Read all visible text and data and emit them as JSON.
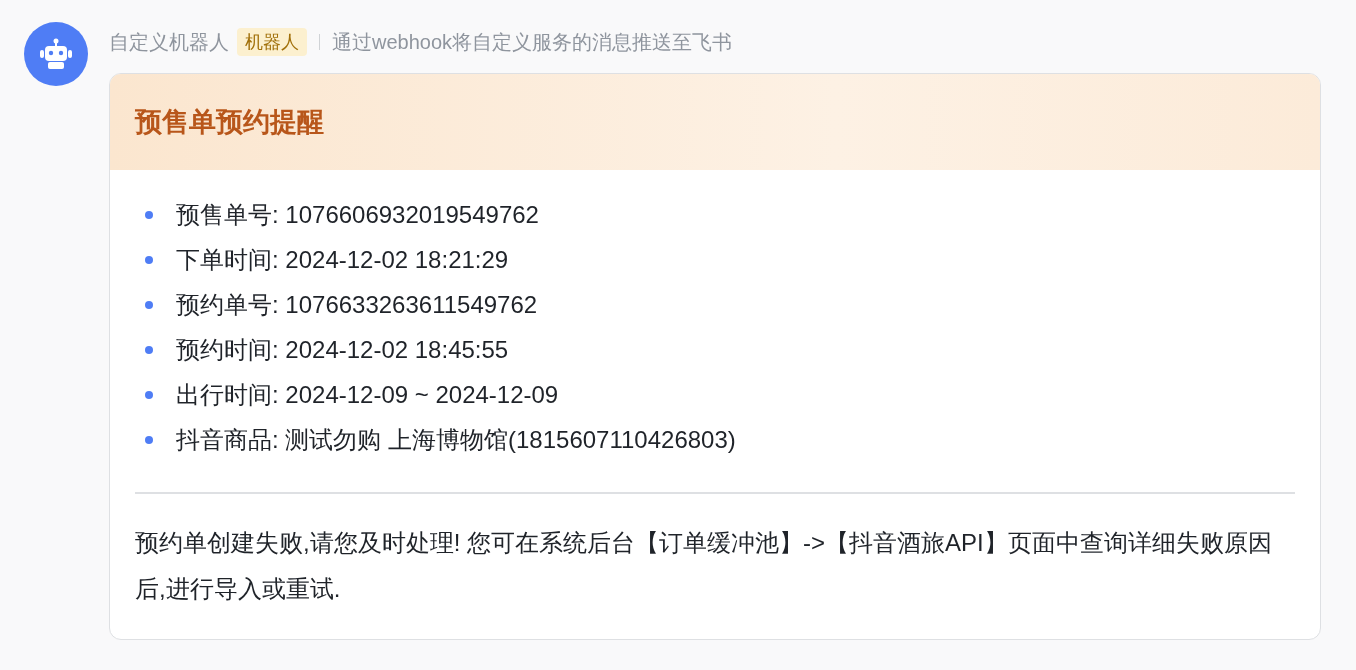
{
  "sender": {
    "name": "自定义机器人",
    "badge": "机器人",
    "description": "通过webhook将自定义服务的消息推送至飞书"
  },
  "card": {
    "title": "预售单预约提醒",
    "items": [
      {
        "label": "预售单号:",
        "value": "1076606932019549762"
      },
      {
        "label": "下单时间:",
        "value": "2024-12-02 18:21:29"
      },
      {
        "label": "预约单号:",
        "value": "1076633263611549762"
      },
      {
        "label": "预约时间:",
        "value": "2024-12-02 18:45:55"
      },
      {
        "label": "出行时间:",
        "value": "2024-12-09 ~ 2024-12-09"
      },
      {
        "label": "抖音商品:",
        "value": "测试勿购 上海博物馆(1815607110426803)"
      }
    ],
    "note": "预约单创建失败,请您及时处理! 您可在系统后台【订单缓冲池】->【抖音酒旅API】页面中查询详细失败原因后,进行导入或重试."
  }
}
